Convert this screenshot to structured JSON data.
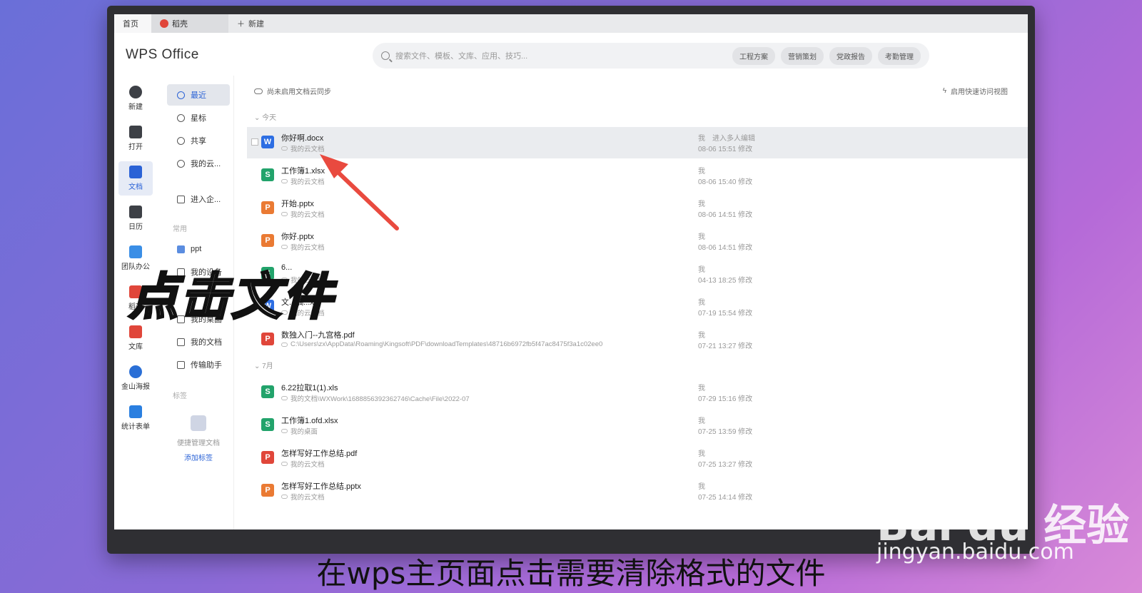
{
  "tabs": {
    "home": "首页",
    "daoke": "稻壳",
    "new": "新建"
  },
  "brand": "WPS Office",
  "search": {
    "placeholder": "搜索文件、模板、文库、应用、技巧...",
    "chips": [
      "工程方案",
      "营销策划",
      "党政报告",
      "考勤管理"
    ]
  },
  "leftbar": [
    "新建",
    "打开",
    "文档",
    "日历",
    "团队办公",
    "稻壳",
    "文库",
    "金山海报",
    "统计表单"
  ],
  "nav": {
    "items": [
      "最近",
      "星标",
      "共享",
      "我的云...",
      "进入企..."
    ],
    "common_header": "常用",
    "common": [
      "ppt",
      "我的设备",
      "我的桌面",
      "我的文档",
      "传输助手"
    ],
    "tags_header": "标签",
    "tags_empty": "便捷管理文档",
    "tags_add": "添加标签"
  },
  "main": {
    "sync_notice": "尚未启用文档云同步",
    "quick_view": "启用快速访问视图",
    "group_today": "今天",
    "group_july": "7月"
  },
  "files": [
    {
      "name": "你好啊.docx",
      "type": "W",
      "color": "#2d6ee3",
      "loc": "我的云文档",
      "owner": "我",
      "collab": "进入多人编辑",
      "date": "08-06 15:51 修改"
    },
    {
      "name": "工作簿1.xlsx",
      "type": "S",
      "color": "#22a36b",
      "loc": "我的云文档",
      "owner": "我",
      "date": "08-06 15:40 修改"
    },
    {
      "name": "开始.pptx",
      "type": "P",
      "color": "#ea7a33",
      "loc": "我的云文档",
      "owner": "我",
      "date": "08-06 14:51 修改"
    },
    {
      "name": "你好.pptx",
      "type": "P",
      "color": "#ea7a33",
      "loc": "我的云文档",
      "owner": "我",
      "date": "08-06 14:51 修改"
    },
    {
      "name": "6...",
      "type": "S",
      "color": "#22a36b",
      "loc": "我的云文档",
      "owner": "我",
      "date": "04-13 18:25 修改"
    },
    {
      "name": "文...稿...x",
      "type": "W",
      "color": "#2d6ee3",
      "loc": "我的云文档",
      "owner": "我",
      "date": "07-19 15:54 修改"
    },
    {
      "name": "数独入门--九宫格.pdf",
      "type": "P",
      "color": "#e0463a",
      "loc": "C:\\Users\\zx\\AppData\\Roaming\\Kingsoft\\PDF\\downloadTemplates\\48716b6972fb5f47ac8475f3a1c02ee0",
      "owner": "我",
      "date": "07-21 13:27 修改"
    },
    {
      "name": "6.22拉取1(1).xls",
      "type": "S",
      "color": "#22a36b",
      "loc": "我的文档\\WXWork\\1688856392362746\\Cache\\File\\2022-07",
      "owner": "我",
      "date": "07-29 15:16 修改"
    },
    {
      "name": "工作簿1.ofd.xlsx",
      "type": "S",
      "color": "#22a36b",
      "loc": "我的桌面",
      "owner": "我",
      "date": "07-25 13:59 修改"
    },
    {
      "name": "怎样写好工作总结.pdf",
      "type": "P",
      "color": "#e0463a",
      "loc": "我的云文档",
      "owner": "我",
      "date": "07-25 13:27 修改"
    },
    {
      "name": "怎样写好工作总结.pptx",
      "type": "P",
      "color": "#ea7a33",
      "loc": "我的云文档",
      "owner": "我",
      "date": "07-25 14:14 修改"
    }
  ],
  "overlay": {
    "big": "点击文件",
    "caption": "在wps主页面点击需要清除格式的文件"
  },
  "watermark": {
    "logo": "Bai du 经验",
    "url": "jingyan.baidu.com"
  }
}
